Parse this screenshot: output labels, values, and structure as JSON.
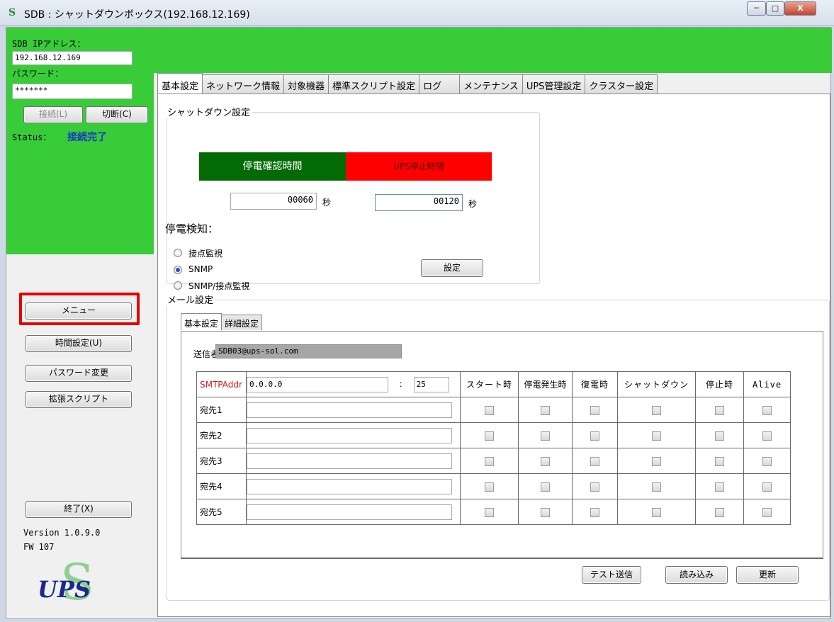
{
  "window": {
    "title": "SDB : シャットダウンボックス(192.168.12.169)",
    "min": "─",
    "max": "□",
    "close": "X"
  },
  "left": {
    "ip_label": "SDB IPアドレス：",
    "ip_value": "192.168.12.169",
    "pw_label": "パスワード：",
    "pw_value": "*******",
    "connect": "接続(L)",
    "disconnect": "切断(C)",
    "status_label": "Status：",
    "status_value": "接続完了",
    "menu": "メニュー",
    "time_settings": "時間設定(U)",
    "change_password": "パスワード変更",
    "ext_script": "拡張スクリプト",
    "exit": "終了(X)",
    "version": "Version 1.0.9.0",
    "fw": "FW 107",
    "logo_text": "UPS",
    "logo_s": "S"
  },
  "tabs": [
    "基本設定",
    "ネットワーク情報",
    "対象機器",
    "標準スクリプト設定",
    "ログ",
    "メンテナンス",
    "UPS管理設定",
    "クラスター設定"
  ],
  "shutdown": {
    "group_title": "シャットダウン設定",
    "outage_confirm": "停電確認時間",
    "ups_stop": "UPS停止時間",
    "outage_value": "00060",
    "ups_value": "00120",
    "unit": "秒",
    "detect_label": "停電検知：",
    "options": [
      "接点監視",
      "SNMP",
      "SNMP/接点監視"
    ],
    "selected": "SNMP",
    "set_button": "設定"
  },
  "mail": {
    "group_title": "メール設定",
    "subtabs": [
      "基本設定",
      "詳細設定"
    ],
    "sender_label": "送信者",
    "sender_value": "SDB03@ups-sol.com",
    "smtp_label": "SMTPAddr",
    "smtp_value": "0.0.0.0",
    "port_sep": ":",
    "port_value": "25",
    "columns": [
      "スタート時",
      "停電発生時",
      "復電時",
      "シャットダウン",
      "停止時",
      "Alive"
    ],
    "recipients": [
      "宛先1",
      "宛先2",
      "宛先3",
      "宛先4",
      "宛先5"
    ],
    "test_send": "テスト送信",
    "load": "読み込み",
    "update": "更新"
  }
}
